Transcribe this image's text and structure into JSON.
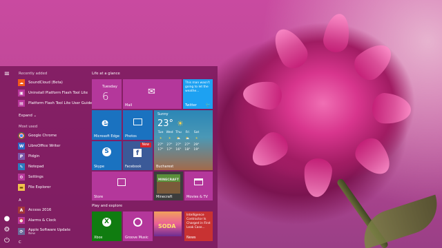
{
  "start_menu": {
    "sections": {
      "recently_added": "Recently added",
      "expand": "Expand",
      "most_used": "Most used",
      "letter_a": "A",
      "letter_c": "C"
    },
    "recent": [
      {
        "name": "SoundCloud (Beta)",
        "icon": "soundcloud-icon",
        "color": "#f05a1a"
      },
      {
        "name": "Uninstall Platform Flash Tool Lite",
        "icon": "uninstall-icon",
        "color": "#b8379b"
      },
      {
        "name": "Platform Flash Tool Lite User Guide",
        "icon": "guide-icon",
        "color": "#b8379b"
      }
    ],
    "most_used": [
      {
        "name": "Google Chrome",
        "icon": "chrome-icon",
        "color": "#ffffff"
      },
      {
        "name": "LibreOffice Writer",
        "icon": "writer-icon",
        "color": "#2b66c3"
      },
      {
        "name": "Pidgin",
        "icon": "pidgin-icon",
        "color": "#7b58a9"
      },
      {
        "name": "Notepad",
        "icon": "notepad-icon",
        "color": "#2b7bbf"
      },
      {
        "name": "Settings",
        "icon": "settings-icon",
        "color": "#b8379b"
      },
      {
        "name": "File Explorer",
        "icon": "folder-icon",
        "color": "#f2c14e"
      }
    ],
    "a_apps": [
      {
        "name": "Access 2016",
        "icon": "access-icon",
        "color": "#a4373a"
      },
      {
        "name": "Alarms & Clock",
        "icon": "alarm-icon",
        "color": "#b8379b"
      },
      {
        "name": "Apple Software Update",
        "sub": "New",
        "icon": "apple-update-icon",
        "color": "#6b6b9a"
      }
    ]
  },
  "tiles": {
    "group1": "Life at a glance",
    "group2": "Play and explore",
    "calendar": {
      "day": "Tuesday",
      "date": "6"
    },
    "mail": "Mail",
    "twitter": {
      "label": "Twitter",
      "text": "This man wasn't going to let the weathe..."
    },
    "edge": "Microsoft Edge",
    "photos": "Photos",
    "weather": {
      "condition": "Sunny",
      "temp": "23°",
      "days": [
        "Tue",
        "Wed",
        "Thu",
        "Fri",
        "Sat"
      ],
      "icons": [
        "☀",
        "☀",
        "⛅",
        "⛅",
        "☀"
      ],
      "highs": [
        "27°",
        "27°",
        "27°",
        "27°",
        "29°"
      ],
      "lows": [
        "17°",
        "17°",
        "16°",
        "18°",
        "19°"
      ],
      "city": "Bucharest"
    },
    "skype": "Skype",
    "facebook": {
      "label": "Facebook",
      "badge": "New"
    },
    "store": "Store",
    "minecraft": {
      "label": "Minecraft",
      "logo": "MINECRAFT"
    },
    "movies": "Movies & TV",
    "xbox": "Xbox",
    "groove": "Groove Music",
    "candy": "SODA",
    "news": {
      "text": "Intelligence Contractor Is Charged in First Leak Case...",
      "label": "News"
    }
  },
  "colors": {
    "tile_magenta": "#b4379b",
    "tile_blue": "#1a72c0",
    "xbox_green": "#107c10",
    "news_red": "#c83232"
  }
}
